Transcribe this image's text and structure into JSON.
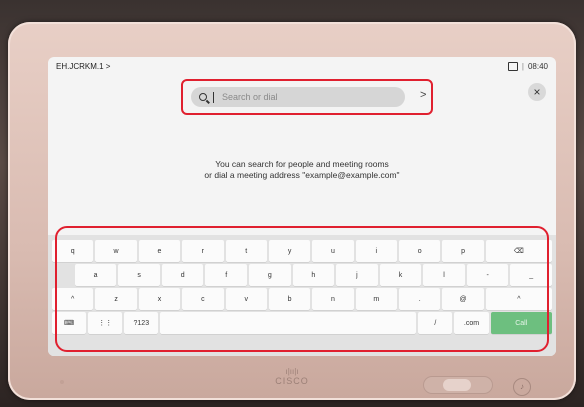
{
  "header": {
    "breadcrumb": "EH.JCRKM.1 >",
    "separator": "|",
    "time": "08:40"
  },
  "search": {
    "placeholder": "Search or dial",
    "submit_label": ">"
  },
  "close_label": "×",
  "hint": {
    "line1": "You can search for people and meeting rooms",
    "line2": "or dial a meeting address \"example@example.com\""
  },
  "keyboard": {
    "row1": [
      "q",
      "w",
      "e",
      "r",
      "t",
      "y",
      "u",
      "i",
      "o",
      "p",
      "⌫"
    ],
    "row2": [
      "a",
      "s",
      "d",
      "f",
      "g",
      "h",
      "j",
      "k",
      "l",
      "-",
      "_"
    ],
    "row3": [
      "^",
      "z",
      "x",
      "c",
      "v",
      "b",
      "n",
      "m",
      ".",
      "@",
      "^"
    ],
    "row4": {
      "hide": "⌨",
      "grid": "⋮⋮",
      "numbers": "?123",
      "slash": "/",
      "dotcom": ".com",
      "call": "Call"
    }
  },
  "device": {
    "brand": "CISCO",
    "brand_mark": "ı|ıı|ı",
    "mic": "♪"
  },
  "colors": {
    "highlight": "#e0202f",
    "call": "#6dbf7f"
  }
}
